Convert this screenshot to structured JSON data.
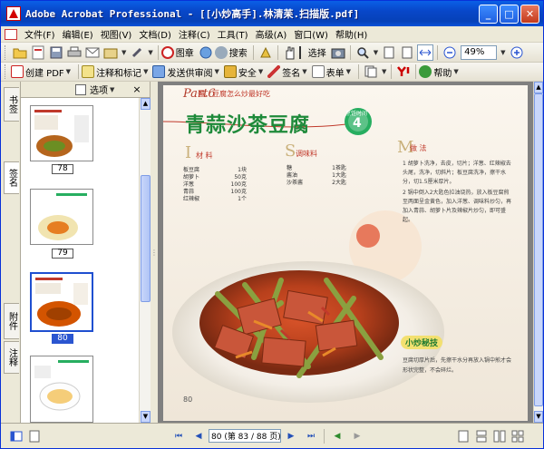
{
  "window": {
    "title": "Adobe Acrobat Professional - [[小炒高手].林清苿.扫描版.pdf]"
  },
  "title_buttons": [
    "_",
    "□",
    "✕"
  ],
  "menu": [
    "文件(F)",
    "编辑(E)",
    "视图(V)",
    "文档(D)",
    "注释(C)",
    "工具(T)",
    "高级(A)",
    "窗口(W)",
    "帮助(H)"
  ],
  "toolbar1": {
    "stamp_label": "图章",
    "search_label": "搜索",
    "select_label": "选择",
    "zoom_value": "49%"
  },
  "toolbar2": {
    "create_pdf": "创建 PDF",
    "comment_markup": "注释和标记",
    "send_review": "发送供审阅",
    "security": "安全",
    "sign": "签名",
    "forms": "表单",
    "help": "帮助"
  },
  "side_tabs": [
    "书签",
    "签名",
    "附件",
    "注释"
  ],
  "pages_panel": {
    "options_label": "选项",
    "thumbnails": [
      {
        "label": "78",
        "selected": false
      },
      {
        "label": "79",
        "selected": false
      },
      {
        "label": "80",
        "selected": true
      }
    ]
  },
  "document_page": {
    "part_label": "Part6",
    "part_subtitle": "蛋、豆腐怎么炒最好吃",
    "dish_title": "青蒜沙茶豆腐",
    "time_label": "烹饪时间",
    "time_value": "4",
    "ingredients_heading_letter": "I",
    "ingredients_heading": "材 料",
    "ingredients": [
      {
        "name": "板豆腐",
        "qty": "1块"
      },
      {
        "name": "胡萝卜",
        "qty": "50克"
      },
      {
        "name": "洋葱",
        "qty": "100克"
      },
      {
        "name": "青蒜",
        "qty": "100克"
      },
      {
        "name": "红辣椒",
        "qty": "1个"
      }
    ],
    "seasoning_heading_letter": "S",
    "seasoning_heading": "调味料",
    "seasonings": [
      {
        "name": "糖",
        "qty": "1茶匙"
      },
      {
        "name": "酱油",
        "qty": "1大匙"
      },
      {
        "name": "沙茶酱",
        "qty": "2大匙"
      }
    ],
    "method_heading_letter": "M",
    "method_heading": "做 法",
    "steps": [
      "1 胡萝卜洗净，去皮，切片；洋葱、红辣椒去头尾，洗净，切斜片；板豆腐洗净，擦干水分，切1.5厘米厚片。",
      "2 锅中倒入2大匙色拉油烧热，放入板豆腐煎至两面呈金黄色，加入洋葱、调味料炒匀，再加入青蒜、胡萝卜片及辣椒片炒匀，即可盛起。"
    ],
    "tip_heading": "小炒秘技",
    "tip_text": "豆腐切厚片后，先擦干水分再放入锅中煎才会形状完整，不会碎烂。",
    "page_number": "80"
  },
  "statusbar": {
    "page_field": "80 (第 83 / 88 页)"
  }
}
